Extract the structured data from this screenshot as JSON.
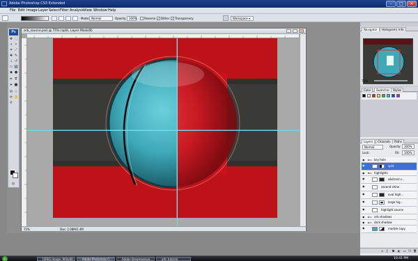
{
  "app": {
    "title": "Adobe Photoshop CS3 Extended"
  },
  "menu": [
    "File",
    "Edit",
    "Image",
    "Layer",
    "Select",
    "Filter",
    "Analysis",
    "View",
    "Window",
    "Help"
  ],
  "options": {
    "mode_label": "Mode:",
    "mode_value": "Normal",
    "opacity_label": "Opacity:",
    "opacity_value": "100%",
    "reverse_label": "Reverse",
    "dither_label": "Dither",
    "transparency_label": "Transparency",
    "workspace_label": "Workspace ▾"
  },
  "document": {
    "title": "orb_source.psd @ 75% (split, Layer Mask/8)",
    "zoom": "75%",
    "doc_size": "Doc: 2.08M/2.4M"
  },
  "navigator": {
    "tabs": [
      "Navigator",
      "Histogram",
      "Info"
    ],
    "zoom": "75%"
  },
  "color_panel": {
    "tabs": [
      "Color",
      "Swatches",
      "Styles"
    ]
  },
  "layers_panel": {
    "tabs": [
      "Layers",
      "Channels",
      "Paths"
    ],
    "blend_mode": "Normal",
    "opacity_label": "Opacity:",
    "opacity_value": "100%",
    "lock_label": "Lock:",
    "fill_label": "Fill:",
    "fill_value": "100%",
    "layers": [
      {
        "name": "key hole",
        "type": "group"
      },
      {
        "name": "split",
        "type": "layer",
        "selected": true
      },
      {
        "name": "highlights",
        "type": "group"
      },
      {
        "name": "abstract s...",
        "type": "layer"
      },
      {
        "name": "second shine",
        "type": "layer"
      },
      {
        "name": "oval high...",
        "type": "layer"
      },
      {
        "name": "large hig...",
        "type": "layer"
      },
      {
        "name": "highlight source",
        "type": "layer"
      },
      {
        "name": "orb shadows",
        "type": "group"
      },
      {
        "name": "dark shadow",
        "type": "group"
      },
      {
        "name": "marble copy",
        "type": "layer"
      }
    ]
  },
  "taskbar": {
    "tasks": [
      "[SPEG Image, 900x60...",
      "Adobe Photoshop C...",
      "Adobe Dreamweave...",
      "orb_tutorial"
    ],
    "clock": "10:41 PM"
  },
  "colors": {
    "canvas_red": "#c8141a",
    "orb_teal": "#3fa9b8",
    "band_dark": "#3a3a36",
    "selection_blue": "#3a70d8"
  }
}
